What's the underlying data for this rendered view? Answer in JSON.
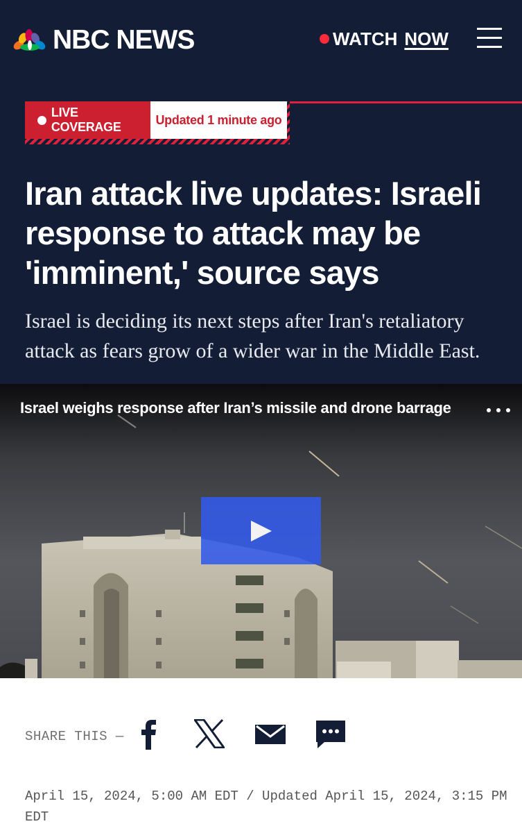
{
  "header": {
    "brand": "NBC NEWS",
    "watch_label": "WATCH",
    "now_label": "NOW",
    "colors": {
      "background": "#131e36",
      "live_red": "#cc1f2f",
      "accent_red": "#e0213b"
    }
  },
  "badge": {
    "live_label": "LIVE COVERAGE",
    "updated_label": "Updated 1 minute ago"
  },
  "article": {
    "headline": "Iran attack live updates: Israeli response to attack may be 'imminent,' source says",
    "dek": "Israel is deciding its next steps after Iran's retaliatory attack as fears grow of a wider war in the Middle East."
  },
  "video": {
    "title": "Israel weighs response after Iran’s missile and drone barrage",
    "play_icon": "play-icon",
    "more_icon": "more-options-icon"
  },
  "share": {
    "label": "SHARE THIS —",
    "icons": [
      "facebook-icon",
      "x-icon",
      "email-icon",
      "sms-icon"
    ]
  },
  "dateline": {
    "text": "April 15, 2024, 5:00 AM EDT / Updated April 15, 2024, 3:15 PM EDT"
  }
}
